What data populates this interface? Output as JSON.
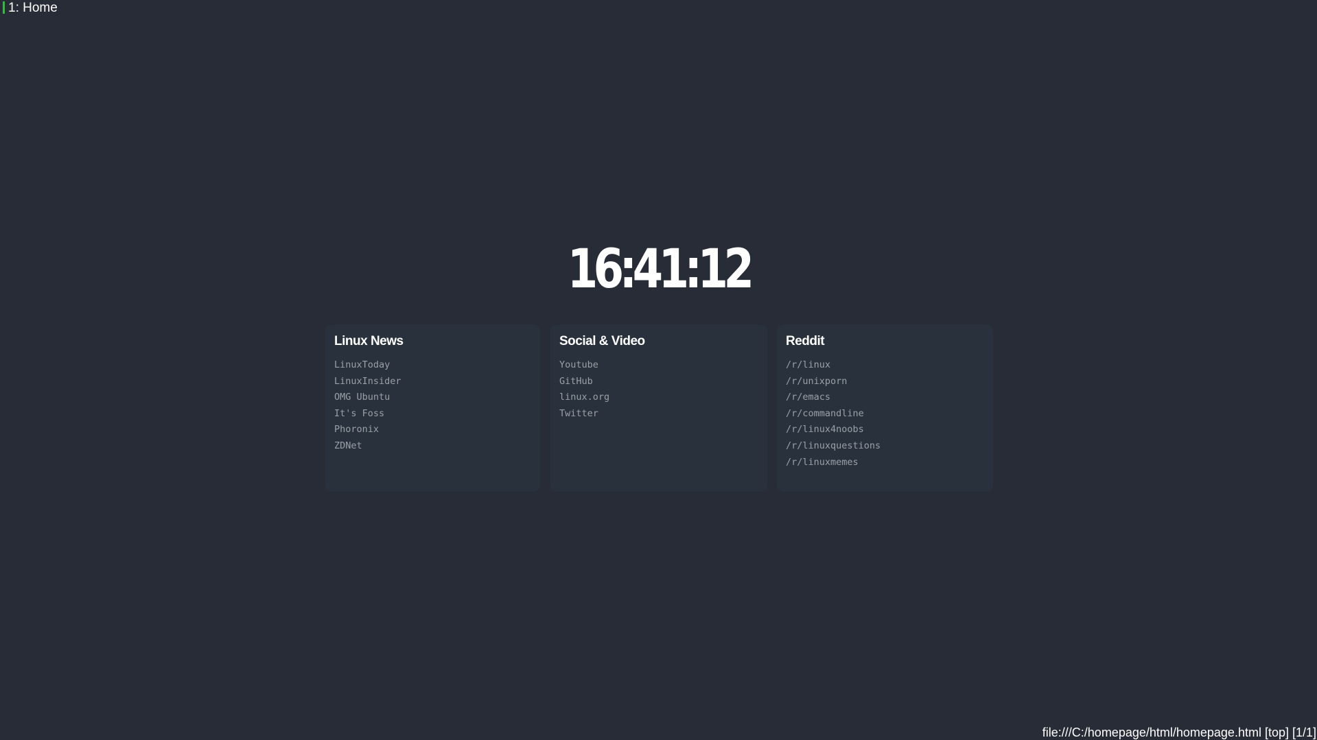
{
  "tab": {
    "title": "1: Home"
  },
  "clock": {
    "time": "16:41:12"
  },
  "panels": [
    {
      "title": "Linux News",
      "links": [
        "LinuxToday",
        "LinuxInsider",
        "OMG Ubuntu",
        "It's Foss",
        "Phoronix",
        "ZDNet"
      ]
    },
    {
      "title": "Social & Video",
      "links": [
        "Youtube",
        "GitHub",
        "linux.org",
        "Twitter"
      ]
    },
    {
      "title": "Reddit",
      "links": [
        "/r/linux",
        "/r/unixporn",
        "/r/emacs",
        "/r/commandline",
        "/r/linux4noobs",
        "/r/linuxquestions",
        "/r/linuxmemes"
      ]
    }
  ],
  "status_bar": {
    "text": "file:///C:/homepage/html/homepage.html [top] [1/1]"
  },
  "colors": {
    "background": "#272c36",
    "panel": "#29323c",
    "link": "#9aa0a7",
    "tab_indicator": "#2fbf3a"
  }
}
